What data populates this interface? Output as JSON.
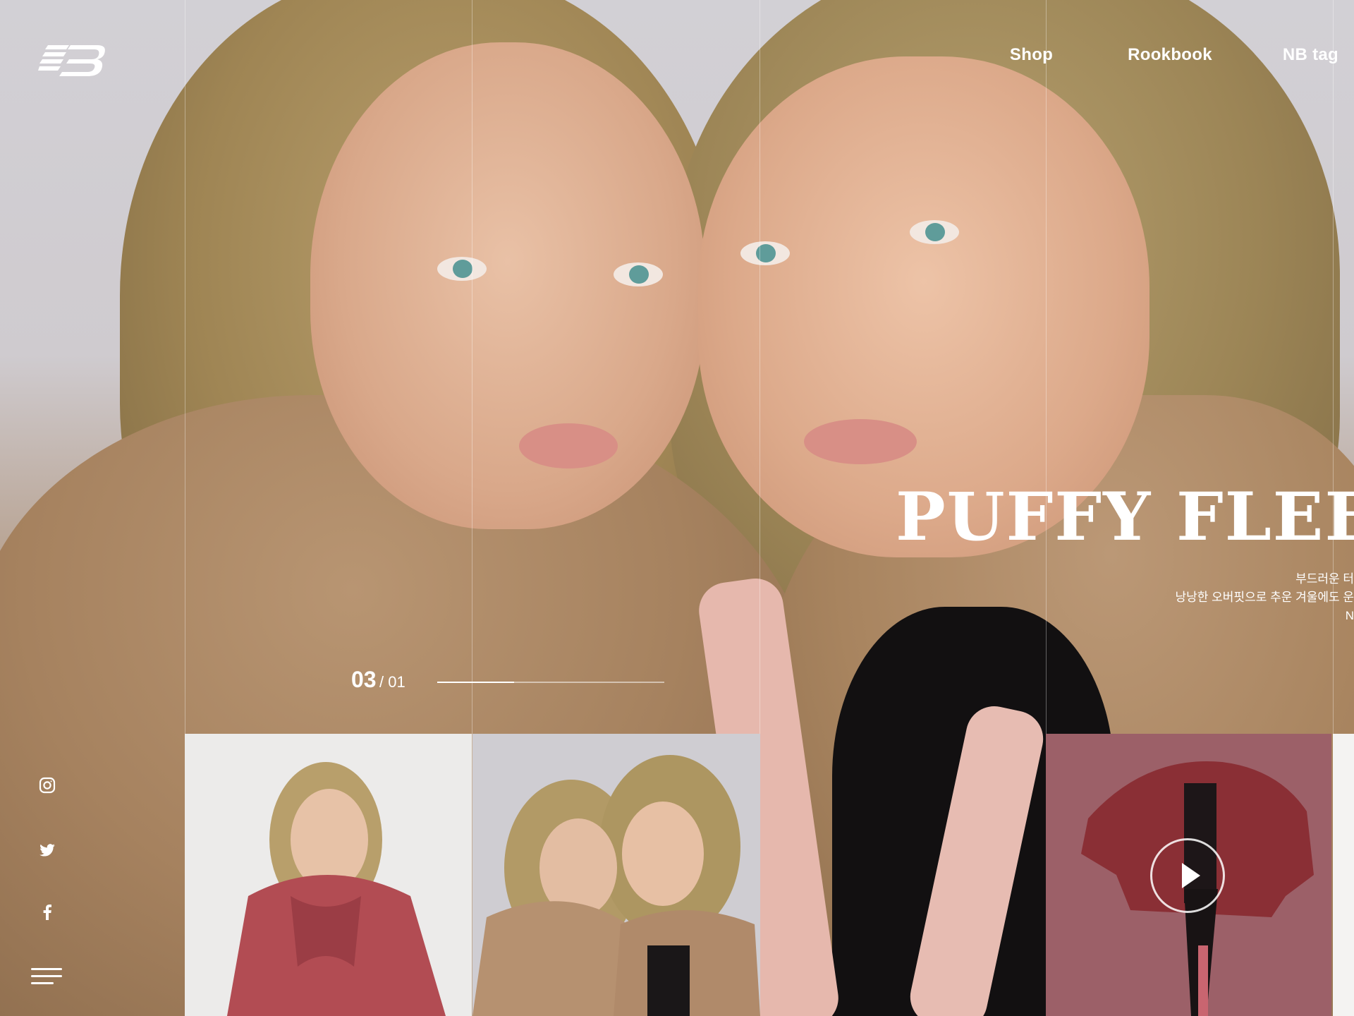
{
  "brand": {
    "logo_icon": "new-balance-logo"
  },
  "nav": {
    "items": [
      "Shop",
      "Rookbook",
      "NB tag"
    ]
  },
  "hero": {
    "title": "PUFFY FLEE",
    "description": [
      "부드러운 터",
      "낭낭한 오버핏으로 추운 겨울에도 운",
      "N"
    ]
  },
  "slider": {
    "current": "03",
    "total": "/ 01",
    "progress": 0.34
  },
  "social": [
    {
      "name": "instagram-icon"
    },
    {
      "name": "twitter-icon"
    },
    {
      "name": "facebook-icon"
    }
  ],
  "menu_icon": "hamburger-menu-icon",
  "thumbnails": [
    {
      "name": "thumbnail-red-fleece-model"
    },
    {
      "name": "thumbnail-two-models"
    },
    {
      "name": "thumbnail-video-product",
      "icon": "play-icon"
    }
  ],
  "colors": {
    "text": "#ffffff",
    "accent_pink": "#9c6068"
  }
}
